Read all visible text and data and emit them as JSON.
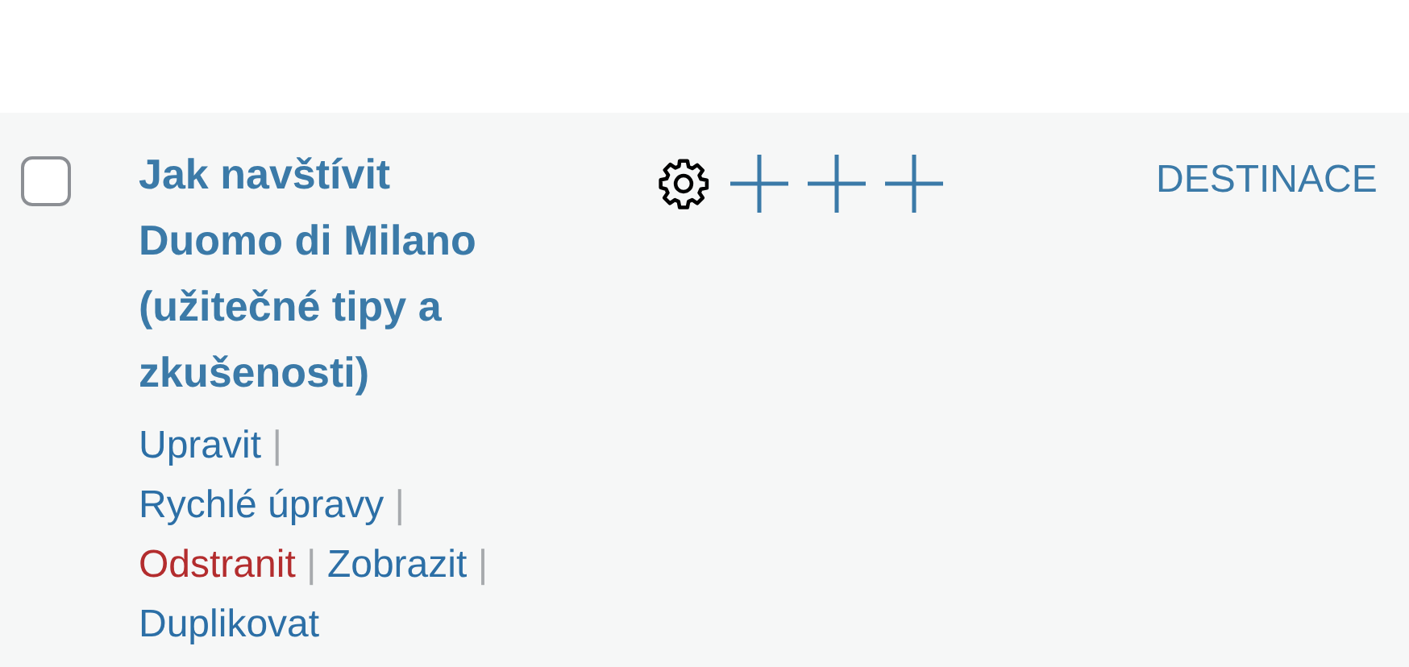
{
  "post_row": {
    "checked": false,
    "title": "Jak navštívit Duomo di Milano (užitečné tipy a zkušenosti)",
    "actions": [
      {
        "label": "Upravit",
        "kind": "normal",
        "separator": "|"
      },
      {
        "label": "Rychlé úpravy",
        "kind": "normal",
        "separator": "|"
      },
      {
        "label": "Odstranit",
        "kind": "delete",
        "separator": "|"
      },
      {
        "label": "Zobrazit",
        "kind": "normal",
        "separator": "|"
      },
      {
        "label": "Duplikovat",
        "kind": "normal"
      }
    ],
    "category": "DESTINACE"
  }
}
